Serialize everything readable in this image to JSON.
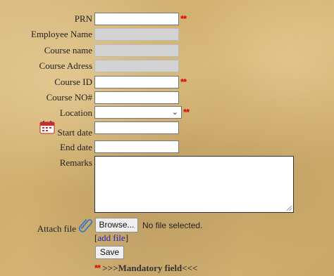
{
  "form": {
    "prn": {
      "label": "PRN",
      "value": "",
      "required_mark": "**"
    },
    "employee_name": {
      "label": "Employee Name",
      "value": ""
    },
    "course_name": {
      "label": "Course name",
      "value": ""
    },
    "course_address": {
      "label": "Course Adress",
      "value": ""
    },
    "course_id": {
      "label": "Course ID",
      "value": "",
      "required_mark": "**"
    },
    "course_no": {
      "label": "Course NO#",
      "value": ""
    },
    "location": {
      "label": "Location",
      "selected": "",
      "required_mark": "**"
    },
    "start_date": {
      "label": "Start date",
      "value": ""
    },
    "end_date": {
      "label": "End date",
      "value": ""
    },
    "remarks": {
      "label": "Remarks",
      "value": ""
    },
    "attach": {
      "label": "Attach file",
      "browse_label": "Browse...",
      "no_file_text": "No file selected.",
      "add_file_open": "[",
      "add_file_link": "add file",
      "add_file_close": "]"
    },
    "save_label": "Save",
    "mandatory": {
      "mark": "**",
      "text": " >>>Mandatory field<<<"
    }
  },
  "icons": {
    "calendar": "calendar-icon",
    "attach": "paperclip-icon",
    "dropdown": "chevron-down-icon"
  },
  "colors": {
    "required": "#e00000",
    "link": "#2323c8",
    "readonly_field": "#d3d3d3"
  }
}
